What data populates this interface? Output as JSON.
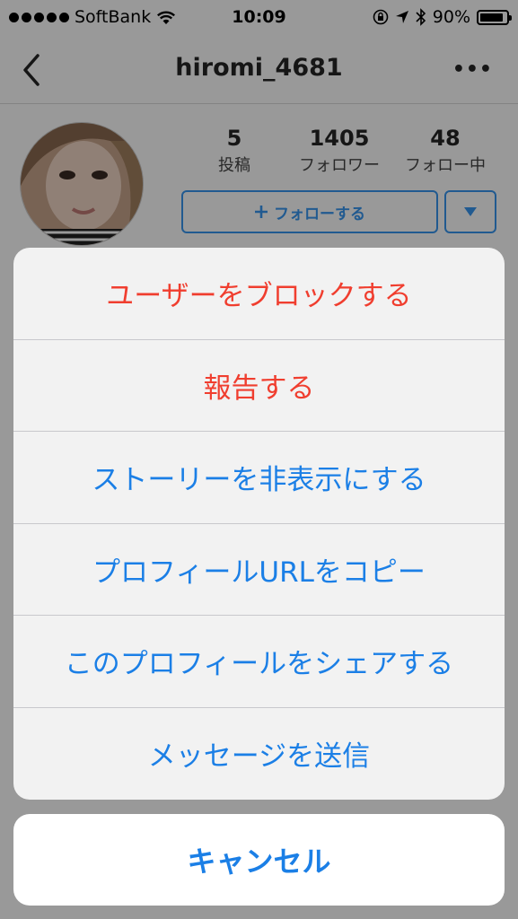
{
  "status_bar": {
    "carrier": "SoftBank",
    "time": "10:09",
    "battery": "90%",
    "battery_level": 0.9
  },
  "nav": {
    "title": "hiromi_4681",
    "more_label": "•••"
  },
  "profile": {
    "stats": [
      {
        "value": "5",
        "label": "投稿"
      },
      {
        "value": "1405",
        "label": "フォロワー"
      },
      {
        "value": "48",
        "label": "フォロー中"
      }
    ],
    "follow_label": "フォローする"
  },
  "action_sheet": {
    "items": [
      {
        "label": "ユーザーをブロックする",
        "style": "destructive"
      },
      {
        "label": "報告する",
        "style": "destructive"
      },
      {
        "label": "ストーリーを非表示にする",
        "style": "normal"
      },
      {
        "label": "プロフィールURLをコピー",
        "style": "normal"
      },
      {
        "label": "このプロフィールをシェアする",
        "style": "normal"
      },
      {
        "label": "メッセージを送信",
        "style": "normal"
      }
    ],
    "cancel_label": "キャンセル"
  },
  "colors": {
    "destructive": "#f03e2f",
    "action_blue": "#1b7fe6",
    "follow_blue": "#3897f0"
  }
}
